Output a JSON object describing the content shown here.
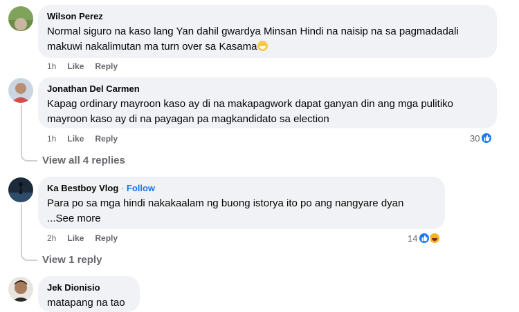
{
  "comments": [
    {
      "author": "Wilson Perez",
      "text": "Normal siguro na kaso lang Yan dahil gwardya Minsan Hindi na naisip na sa pagmadadali makuwi nakalimutan ma turn over sa Kasama",
      "emoji": "grin-sweat-emoji",
      "time": "1h",
      "like": "Like",
      "reply": "Reply"
    },
    {
      "author": "Jonathan Del Carmen",
      "text": "Kapag ordinary mayroon kaso ay di na makapagwork dapat ganyan din ang mga pulitiko mayroon kaso ay di na payagan pa magkandidato sa election",
      "time": "1h",
      "like": "Like",
      "reply": "Reply",
      "reaction_count": "30",
      "view_replies": "View all 4 replies"
    },
    {
      "author": "Ka Bestboy Vlog",
      "separator": "·",
      "follow": "Follow",
      "text": "Para po sa mga hindi nakakaalam ng buong istorya ito po ang nangyare dyan",
      "see_more": "...See more",
      "time": "2h",
      "like": "Like",
      "reply": "Reply",
      "reaction_count": "14",
      "view_replies": "View 1 reply"
    },
    {
      "author": "Jek Dionisio",
      "text": "matapang na tao"
    }
  ],
  "colors": {
    "bubble": "#f0f2f5",
    "link_blue": "#1877f2",
    "meta_gray": "#65676b",
    "like_blue": "#1877f2",
    "haha_yellow": "#f7b125"
  }
}
